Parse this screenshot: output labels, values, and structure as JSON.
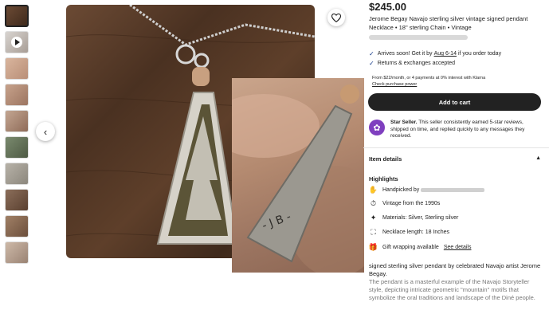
{
  "listing": {
    "price": "$245.00",
    "title": "Jerome Begay Navajo sterling silver vintage signed pendant Necklace • 18\" sterling Chain • Vintage",
    "delivery_prefix": "Arrives soon! Get it by ",
    "delivery_dates": "Aug 6-14",
    "delivery_suffix": " if you order today",
    "returns": "Returns & exchanges accepted",
    "klarna_line": "From $22/month, or 4 payments at 0% interest with Klarna",
    "klarna_link": "Check purchase power",
    "add_to_cart": "Add to cart",
    "star_seller_title": "Star Seller.",
    "star_seller_text": " This seller consistently earned 5-star reviews, shipped on time, and replied quickly to any messages they received."
  },
  "item_details": {
    "heading": "Item details",
    "highlights_heading": "Highlights",
    "handpicked": "Handpicked by",
    "vintage": "Vintage from the 1990s",
    "materials": "Materials: Silver, Sterling silver",
    "necklace_length": "Necklace length: 18 Inches",
    "gift_wrapping": "Gift wrapping available",
    "see_details": "See details"
  },
  "description": {
    "p1": "signed sterling silver pendant by celebrated Navajo artist Jerome Begay.",
    "p2": "The pendant is a masterful example of the Navajo Storyteller style, depicting intricate geometric \"mountain\" motifs that symbolize the oral traditions and landscape of the Diné people."
  },
  "icons": {
    "prev": "chevron-left-icon",
    "favorite": "heart-icon",
    "play": "play-icon",
    "check": "check-icon",
    "chevron_up": "chevron-up-icon"
  },
  "colors": {
    "accent_dark": "#222222",
    "check_blue": "#1a3e8c",
    "star_seller_purple": "#7f3fbf"
  }
}
